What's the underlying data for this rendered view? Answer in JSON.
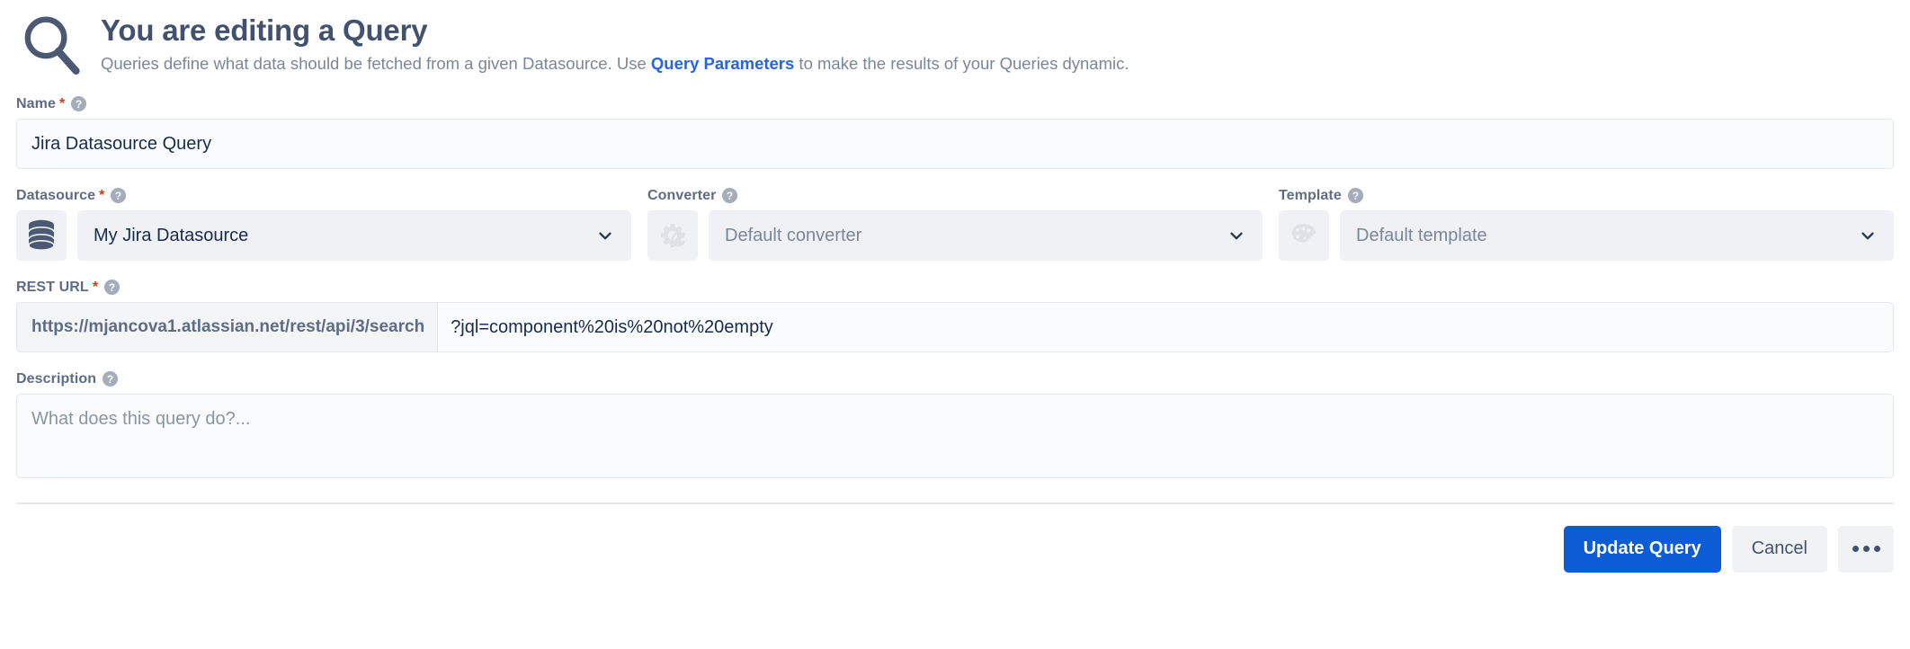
{
  "header": {
    "icon": "magnifier-icon",
    "title": "You are editing a Query",
    "subtitle_before": "Queries define what data should be fetched from a given Datasource. Use ",
    "subtitle_link": "Query Parameters",
    "subtitle_after": " to make the results of your Queries dynamic."
  },
  "fields": {
    "name": {
      "label": "Name",
      "required": "*",
      "help": "?",
      "value": "Jira Datasource Query",
      "placeholder": ""
    },
    "datasource": {
      "label": "Datasource",
      "required": "*",
      "help": "?",
      "icon": "database-icon",
      "value": "My Jira Datasource",
      "chevron": "chevron-down-icon"
    },
    "converter": {
      "label": "Converter",
      "help": "?",
      "icon": "gear-refresh-icon",
      "value": "Default converter",
      "chevron": "chevron-down-icon"
    },
    "template": {
      "label": "Template",
      "help": "?",
      "icon": "palette-icon",
      "value": "Default template",
      "chevron": "chevron-down-icon"
    },
    "rest_url": {
      "label": "REST URL",
      "required": "*",
      "help": "?",
      "prefix": "https://mjancova1.atlassian.net/rest/api/3/search",
      "value": "?jql=component%20is%20not%20empty",
      "placeholder": ""
    },
    "description": {
      "label": "Description",
      "help": "?",
      "value": "",
      "placeholder": "What does this query do?..."
    }
  },
  "footer": {
    "update_label": "Update Query",
    "cancel_label": "Cancel",
    "more_label": "..."
  },
  "colors": {
    "primary": "#0b5cd5",
    "link": "#2563eb",
    "required": "#de350b",
    "label": "#5e6c84",
    "text": "#172b4d",
    "icon": "#4b5a72",
    "field_bg": "#fafbfc",
    "select_bg": "#f0f1f4"
  }
}
